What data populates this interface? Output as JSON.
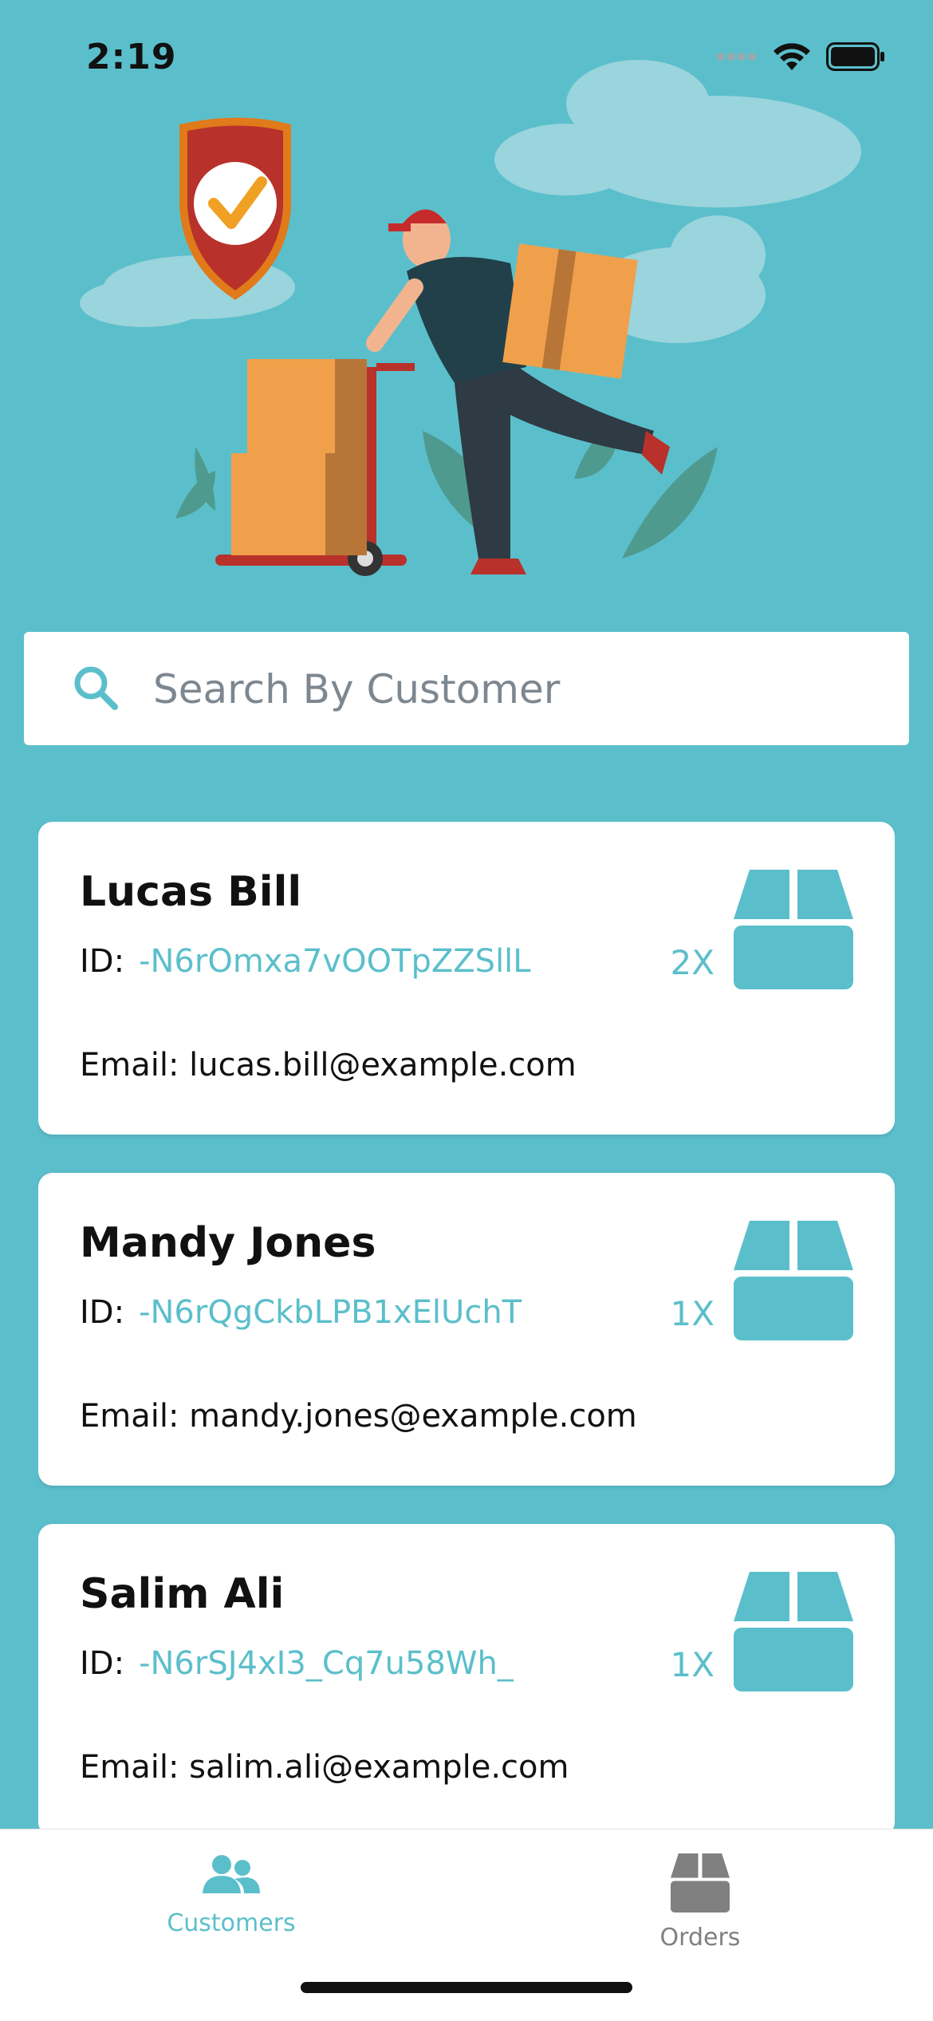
{
  "status_bar": {
    "time": "2:19"
  },
  "search": {
    "placeholder": "Search By Customer"
  },
  "customers": [
    {
      "name": "Lucas Bill",
      "id_label": "ID:",
      "id": "-N6rOmxa7vOOTpZZSllL",
      "count": "2X",
      "email_label": "Email:",
      "email": "lucas.bill@example.com"
    },
    {
      "name": "Mandy Jones",
      "id_label": "ID:",
      "id": "-N6rQgCkbLPB1xElUchT",
      "count": "1X",
      "email_label": "Email:",
      "email": "mandy.jones@example.com"
    },
    {
      "name": "Salim Ali",
      "id_label": "ID:",
      "id": "-N6rSJ4xI3_Cq7u58Wh_",
      "count": "1X",
      "email_label": "Email:",
      "email": "salim.ali@example.com"
    }
  ],
  "tabs": [
    {
      "label": "Customers",
      "icon": "users-icon",
      "active": true
    },
    {
      "label": "Orders",
      "icon": "box-icon",
      "active": false
    }
  ],
  "colors": {
    "accent": "#5bbfcb",
    "background": "#5bbfcb",
    "inactive_tab": "#808080"
  }
}
